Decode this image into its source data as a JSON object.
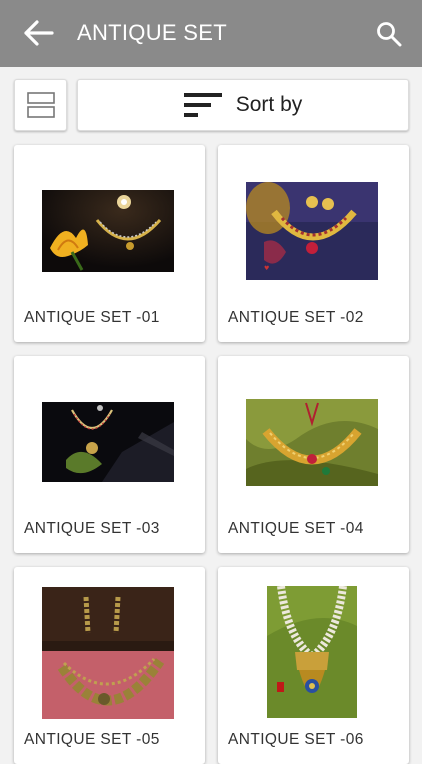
{
  "appbar": {
    "title": "ANTIQUE SET",
    "back_icon": "arrow-left-icon",
    "search_icon": "search-icon",
    "background": "#8a8a8a"
  },
  "toolbar": {
    "view_toggle_icon": "grid-list-toggle-icon",
    "sort_icon": "sort-icon",
    "sort_label": "Sort by"
  },
  "products": [
    {
      "name": "ANTIQUE SET -01"
    },
    {
      "name": "ANTIQUE SET -02"
    },
    {
      "name": "ANTIQUE SET -03"
    },
    {
      "name": "ANTIQUE SET -04"
    },
    {
      "name": "ANTIQUE SET -05"
    },
    {
      "name": "ANTIQUE SET -06"
    }
  ]
}
